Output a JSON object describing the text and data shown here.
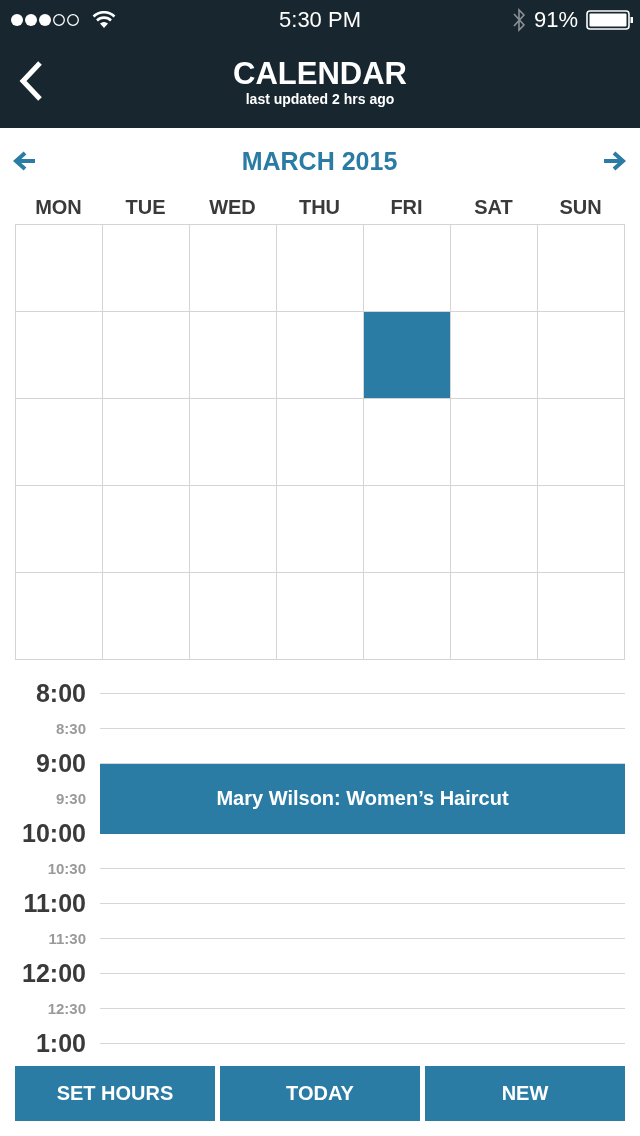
{
  "status_bar": {
    "time": "5:30 PM",
    "battery": "91%"
  },
  "header": {
    "title": "CALENDAR",
    "subtitle": "last updated 2 hrs ago"
  },
  "month": {
    "title": "MARCH 2015"
  },
  "weekdays": [
    "MON",
    "TUE",
    "WED",
    "THU",
    "FRI",
    "SAT",
    "SUN"
  ],
  "days": [
    {
      "selected": false
    },
    {
      "selected": false
    },
    {
      "selected": false
    },
    {
      "selected": false
    },
    {
      "selected": false
    },
    {
      "selected": false
    },
    {
      "selected": false
    },
    {
      "selected": false
    },
    {
      "selected": false
    },
    {
      "selected": false
    },
    {
      "selected": false
    },
    {
      "selected": true
    },
    {
      "selected": false
    },
    {
      "selected": false
    },
    {
      "selected": false
    },
    {
      "selected": false
    },
    {
      "selected": false
    },
    {
      "selected": false
    },
    {
      "selected": false
    },
    {
      "selected": false
    },
    {
      "selected": false
    },
    {
      "selected": false
    },
    {
      "selected": false
    },
    {
      "selected": false
    },
    {
      "selected": false
    },
    {
      "selected": false
    },
    {
      "selected": false
    },
    {
      "selected": false
    },
    {
      "selected": false
    },
    {
      "selected": false
    },
    {
      "selected": false
    },
    {
      "selected": false
    },
    {
      "selected": false
    },
    {
      "selected": false
    },
    {
      "selected": false
    }
  ],
  "slots": [
    {
      "time": "8:00",
      "kind": "hour",
      "booked": false
    },
    {
      "time": "8:30",
      "kind": "half",
      "booked": false
    },
    {
      "time": "9:00",
      "kind": "hour",
      "booked": true
    },
    {
      "time": "9:30",
      "kind": "half",
      "booked": true
    },
    {
      "time": "10:00",
      "kind": "hour",
      "booked": false
    },
    {
      "time": "10:30",
      "kind": "half",
      "booked": false
    },
    {
      "time": "11:00",
      "kind": "hour",
      "booked": false
    },
    {
      "time": "11:30",
      "kind": "half",
      "booked": false
    },
    {
      "time": "12:00",
      "kind": "hour",
      "booked": false
    },
    {
      "time": "12:30",
      "kind": "half",
      "booked": false
    },
    {
      "time": "1:00",
      "kind": "hour",
      "booked": false
    }
  ],
  "appointment": {
    "title": "Mary Wilson: Women’s Haircut"
  },
  "buttons": [
    "SET HOURS",
    "TODAY",
    "NEW"
  ]
}
